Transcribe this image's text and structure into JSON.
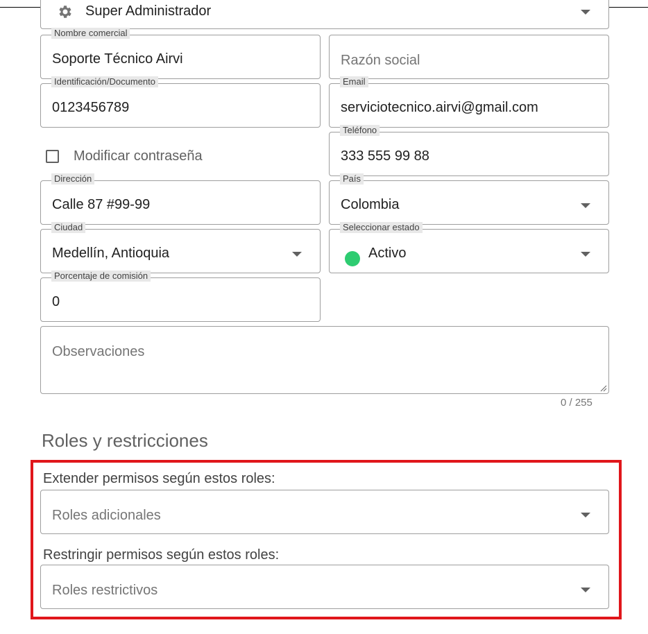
{
  "profile": {
    "value": "Super Administrador"
  },
  "fields": {
    "nombre_comercial": {
      "label": "Nombre comercial",
      "value": "Soporte Técnico Airvi"
    },
    "razon_social": {
      "placeholder": "Razón social"
    },
    "identificacion": {
      "label": "Identificación/Documento",
      "value": "0123456789"
    },
    "email": {
      "label": "Email",
      "value": "serviciotecnico.airvi@gmail.com"
    },
    "modificar_contrasena": {
      "label": "Modificar contraseña"
    },
    "telefono": {
      "label": "Teléfono",
      "value": "333 555 99 88"
    },
    "direccion": {
      "label": "Dirección",
      "value": "Calle 87 #99-99"
    },
    "pais": {
      "label": "País",
      "value": "Colombia"
    },
    "ciudad": {
      "label": "Ciudad",
      "value": "Medellín, Antioquia"
    },
    "estado": {
      "label": "Seleccionar estado",
      "value": "Activo",
      "status_color": "#2ecc71"
    },
    "comision": {
      "label": "Porcentaje de comisión",
      "value": "0"
    },
    "observaciones": {
      "placeholder": "Observaciones",
      "counter": "0 / 255"
    }
  },
  "roles": {
    "title": "Roles y restricciones",
    "extender_label": "Extender permisos según estos roles:",
    "extender_placeholder": "Roles adicionales",
    "restringir_label": "Restringir permisos según estos roles:",
    "restringir_placeholder": "Roles restrictivos",
    "highlight_color": "#e0161b"
  }
}
